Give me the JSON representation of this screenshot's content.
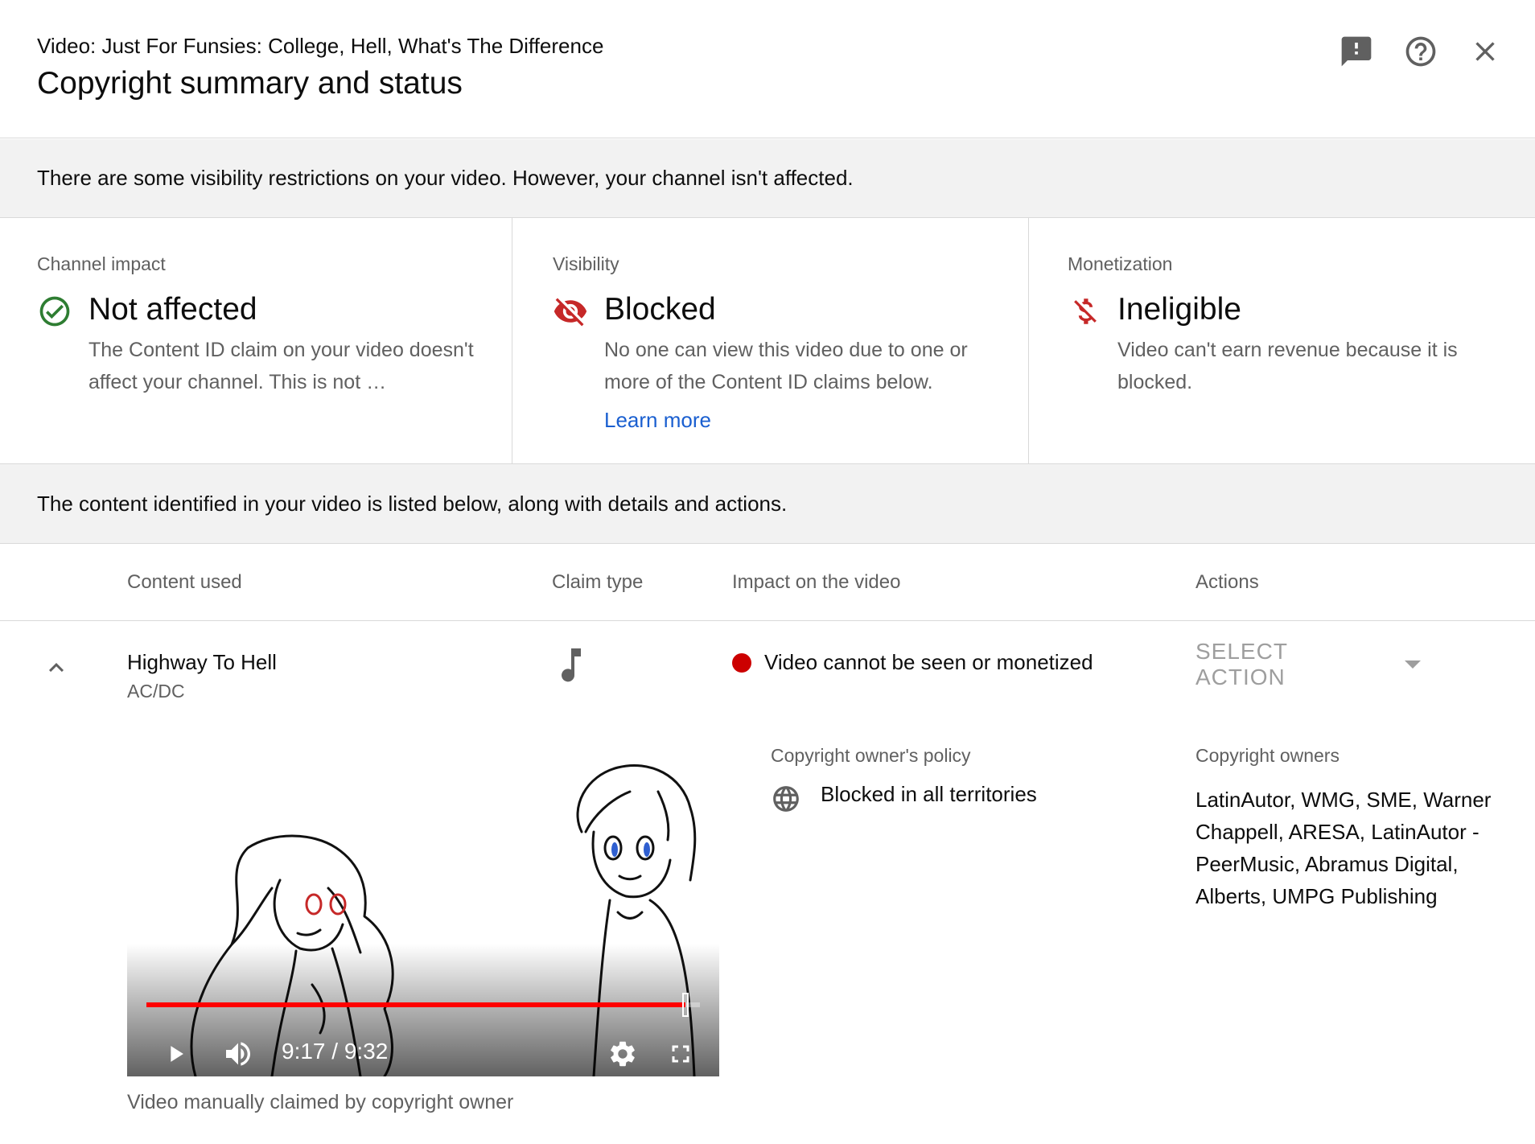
{
  "header": {
    "video_label": "Video: Just For Funsies: College, Hell, What's The Difference",
    "title": "Copyright summary and status",
    "icons": [
      "feedback-icon",
      "help-icon",
      "close-icon"
    ]
  },
  "banner_top": "There are some visibility restrictions on your video. However, your channel isn't affected.",
  "cards": {
    "channel": {
      "label": "Channel impact",
      "heading": "Not affected",
      "description": "The Content ID claim on your video doesn't affect your channel. This is not …",
      "icon": "check-circle-icon",
      "color": "#2e7d32"
    },
    "visibility": {
      "label": "Visibility",
      "heading": "Blocked",
      "description": "No one can view this video due to one or more of the Content ID claims below.",
      "link": "Learn more",
      "icon": "eye-off-icon",
      "color": "#c62828"
    },
    "monetization": {
      "label": "Monetization",
      "heading": "Ineligible",
      "description": "Video can't earn revenue because it is blocked.",
      "icon": "money-off-icon",
      "color": "#c62828"
    }
  },
  "banner_content": "The content identified in your video is listed below, along with details and actions.",
  "table": {
    "headers": [
      "Content used",
      "Claim type",
      "Impact on the video",
      "Actions"
    ]
  },
  "claim": {
    "title": "Highway To Hell",
    "artist": "AC/DC",
    "claim_type_icon": "music-note-icon",
    "impact": "Video cannot be seen or monetized",
    "impact_color": "#cc0000",
    "action_label": "SELECT ACTION",
    "player": {
      "time": "9:17 / 9:32",
      "progress": 0.9737
    },
    "policy_label": "Copyright owner's policy",
    "policy": "Blocked in all territories",
    "owners_label": "Copyright owners",
    "owners": "LatinAutor, WMG, SME, Warner Chappell, ARESA, LatinAutor - PeerMusic, Abramus Digital, Alberts, UMPG Publishing",
    "note": "Video manually claimed by copyright owner"
  }
}
